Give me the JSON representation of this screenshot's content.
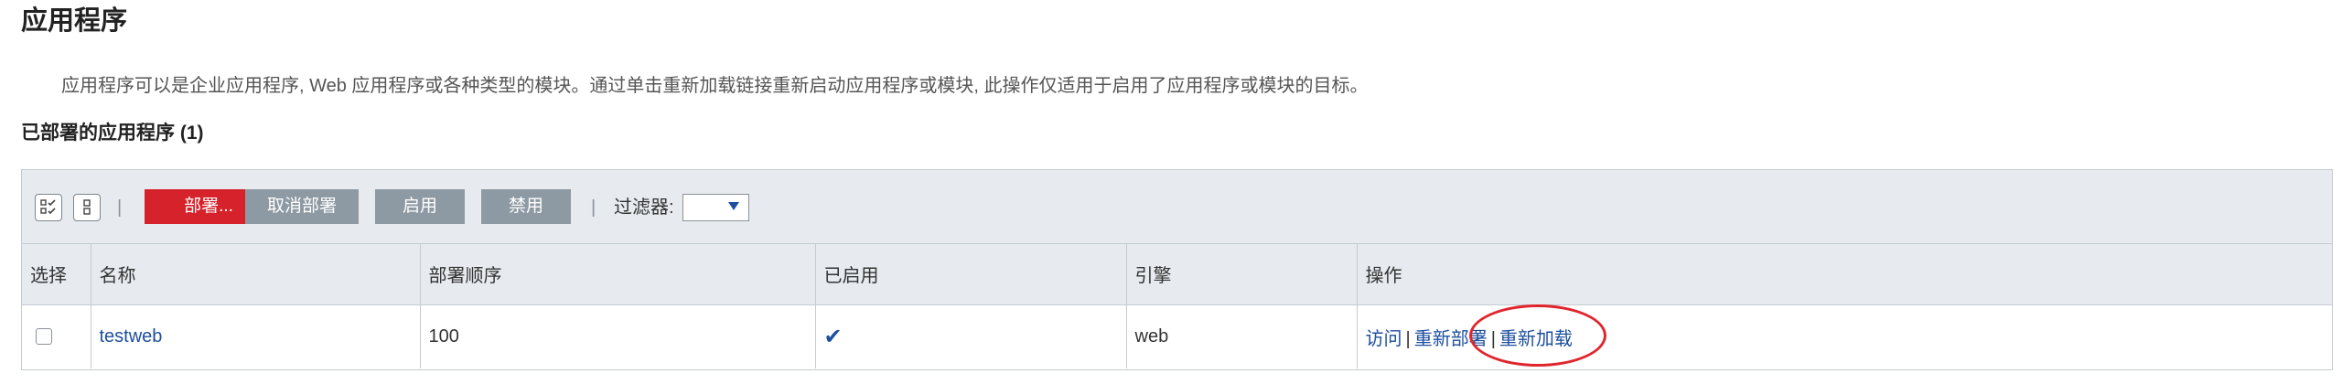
{
  "page": {
    "title": "应用程序",
    "description": "应用程序可以是企业应用程序, Web 应用程序或各种类型的模块。通过单击重新加载链接重新启动应用程序或模块, 此操作仅适用于启用了应用程序或模块的目标。",
    "section_title": "已部署的应用程序 (1)"
  },
  "toolbar": {
    "icons": [
      "select-all-icon",
      "deselect-all-icon"
    ],
    "buttons": {
      "deploy": "部署...",
      "undeploy": "取消部署",
      "enable": "启用",
      "disable": "禁用"
    },
    "filter_label": "过滤器:",
    "filter_value": ""
  },
  "table": {
    "headers": [
      "选择",
      "名称",
      "部署顺序",
      "已启用",
      "引擎",
      "操作"
    ],
    "rows": [
      {
        "name": "testweb",
        "order": "100",
        "enabled": "✔",
        "engine": "web",
        "actions": [
          "访问",
          "重新部署",
          "重新加载"
        ],
        "separator": "|"
      }
    ]
  },
  "colors": {
    "accent_red": "#d5222b",
    "button_gray": "#8e9aa3",
    "link_blue": "#1d4f9e",
    "toolbar_bg": "#e7ebef",
    "annotation_red": "#e0262d"
  }
}
